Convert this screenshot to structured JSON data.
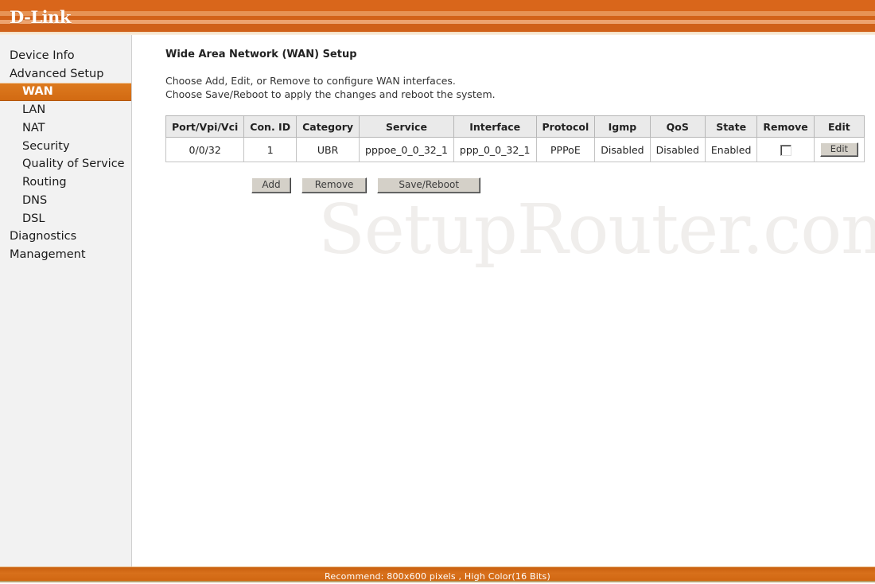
{
  "brand": {
    "logo_text": "D-Link"
  },
  "sidebar": {
    "items": [
      {
        "label": "Device Info",
        "level": "top",
        "active": false
      },
      {
        "label": "Advanced Setup",
        "level": "top",
        "active": false
      },
      {
        "label": "WAN",
        "level": "sub",
        "active": true
      },
      {
        "label": "LAN",
        "level": "sub",
        "active": false
      },
      {
        "label": "NAT",
        "level": "sub",
        "active": false
      },
      {
        "label": "Security",
        "level": "sub",
        "active": false
      },
      {
        "label": "Quality of Service",
        "level": "sub",
        "active": false
      },
      {
        "label": "Routing",
        "level": "sub",
        "active": false
      },
      {
        "label": "DNS",
        "level": "sub",
        "active": false
      },
      {
        "label": "DSL",
        "level": "sub",
        "active": false
      },
      {
        "label": "Diagnostics",
        "level": "top",
        "active": false
      },
      {
        "label": "Management",
        "level": "top",
        "active": false
      }
    ]
  },
  "main": {
    "title": "Wide Area Network (WAN) Setup",
    "description_line1": "Choose Add, Edit, or Remove to configure WAN interfaces.",
    "description_line2": "Choose Save/Reboot to apply the changes and reboot the system.",
    "watermark": "SetupRouter.com",
    "table": {
      "columns": [
        "Port/Vpi/Vci",
        "Con. ID",
        "Category",
        "Service",
        "Interface",
        "Protocol",
        "Igmp",
        "QoS",
        "State",
        "Remove",
        "Edit"
      ],
      "rows": [
        {
          "port_vpi_vci": "0/0/32",
          "con_id": "1",
          "category": "UBR",
          "service": "pppoe_0_0_32_1",
          "interface": "ppp_0_0_32_1",
          "protocol": "PPPoE",
          "igmp": "Disabled",
          "qos": "Disabled",
          "state": "Enabled",
          "remove_checked": false,
          "edit_label": "Edit"
        }
      ]
    },
    "buttons": {
      "add": "Add",
      "remove": "Remove",
      "save_reboot": "Save/Reboot"
    }
  },
  "footer": {
    "text": "Recommend: 800x600 pixels , High Color(16 Bits)"
  },
  "colors": {
    "accent_orange": "#d9661b",
    "active_item": "#d9731a",
    "header_gradient_top": "#d9661b",
    "footer_bar": "#d0690f",
    "table_header_bg": "#eaeaea",
    "sidebar_bg": "#f2f2f2",
    "watermark": "#f0eeec"
  }
}
